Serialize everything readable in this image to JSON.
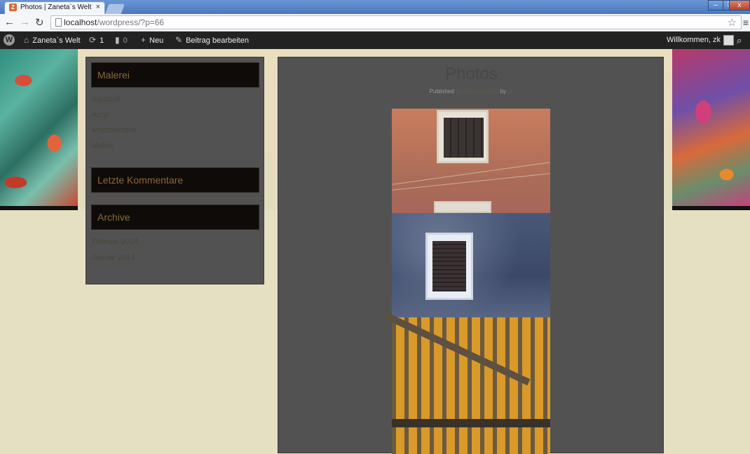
{
  "browser": {
    "tab_title": "Photos | Zaneta`s Welt",
    "tab_close": "×",
    "url_host": "localhost",
    "url_path": "/wordpress/?p=66",
    "window_buttons": [
      "–",
      "❐",
      "x"
    ]
  },
  "adminbar": {
    "site_name": "Zaneta`s Welt",
    "updates_count": "1",
    "comments_count": "0",
    "new_label": "Neu",
    "edit_label": "Beitrag bearbeiten",
    "welcome": "Willkommen, zk"
  },
  "sidebar": {
    "widgets": [
      {
        "title": "Malerei",
        "links": [
          "Aquarell",
          "Acryl",
          "Mischtechnik",
          "Malen"
        ]
      },
      {
        "title": "Letzte Kommentare",
        "links": []
      },
      {
        "title": "Archive",
        "links": [
          "Februar 2014",
          "Januar 2014"
        ]
      }
    ]
  },
  "post": {
    "title": "Photos",
    "meta_published": "Published",
    "meta_date": "21. Februar 2014",
    "meta_by": "by",
    "meta_author": "zk"
  },
  "icons": {
    "wp": "wordpress-icon",
    "home": "home-icon",
    "updates": "refresh-icon",
    "comments": "comment-icon",
    "new": "plus-icon",
    "edit": "pencil-icon",
    "search": "search-icon"
  }
}
